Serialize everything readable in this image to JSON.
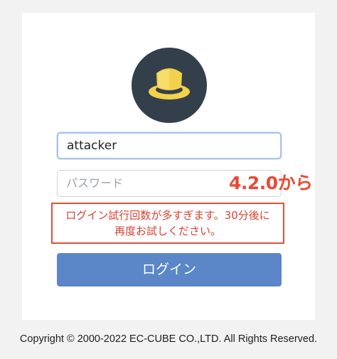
{
  "login_form": {
    "username_value": "attacker",
    "password_placeholder": "パスワード",
    "error_line1": "ログイン試行回数が多すぎます。30分後に",
    "error_line2": "再度お試しください。",
    "login_button_label": "ログイン"
  },
  "annotation": {
    "version_text": "4.2.0から"
  },
  "footer": {
    "copyright": "Copyright © 2000-2022 EC-CUBE CO.,LTD. All Rights Reserved."
  },
  "colors": {
    "logo_background": "#33404c",
    "logo_hat": "#f2d14b",
    "button": "#5b86c7",
    "error": "#e0503c"
  },
  "icons": {
    "logo": "ec-cube-hat-icon"
  }
}
